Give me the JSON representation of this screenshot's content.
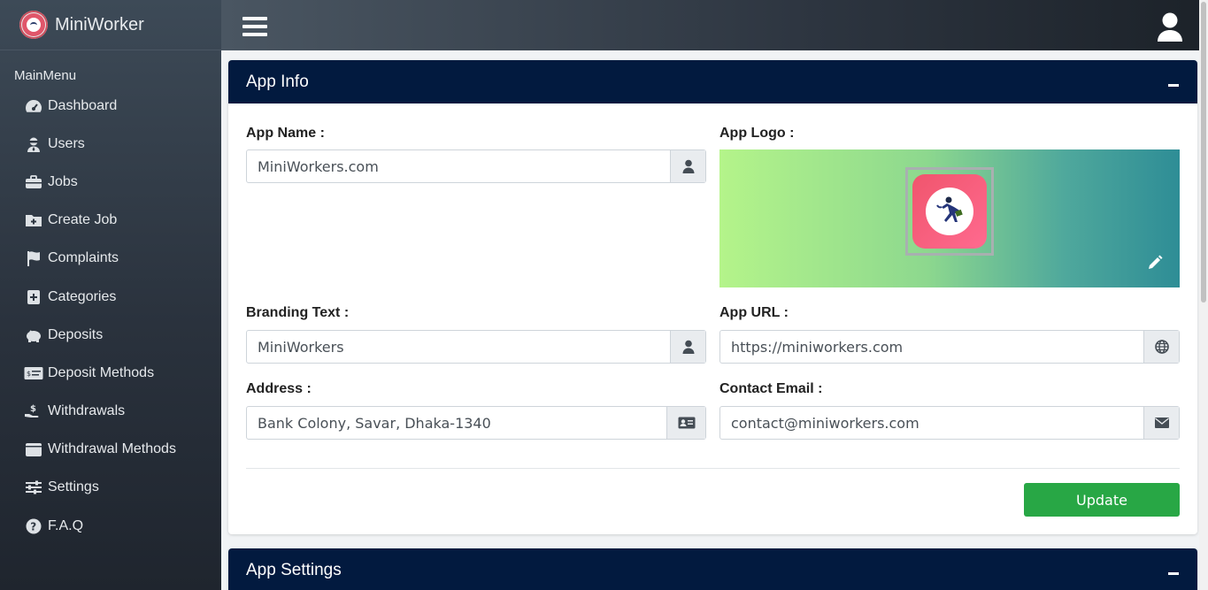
{
  "brand": {
    "name": "MiniWorker"
  },
  "sidebar": {
    "section_title": "MainMenu",
    "items": [
      {
        "label": "Dashboard",
        "icon": "tachometer-icon"
      },
      {
        "label": "Users",
        "icon": "user-secret-icon"
      },
      {
        "label": "Jobs",
        "icon": "briefcase-icon"
      },
      {
        "label": "Create Job",
        "icon": "folder-plus-icon"
      },
      {
        "label": "Complaints",
        "icon": "flag-icon"
      },
      {
        "label": "Categories",
        "icon": "plus-square-icon"
      },
      {
        "label": "Deposits",
        "icon": "piggy-bank-icon"
      },
      {
        "label": "Deposit Methods",
        "icon": "money-check-icon"
      },
      {
        "label": "Withdrawals",
        "icon": "hand-holding-usd-icon"
      },
      {
        "label": "Withdrawal Methods",
        "icon": "wallet-icon"
      },
      {
        "label": "Settings",
        "icon": "sliders-icon"
      },
      {
        "label": "F.A.Q",
        "icon": "question-circle-icon"
      }
    ]
  },
  "app_info": {
    "title": "App Info",
    "app_name_label": "App Name :",
    "app_name_value": "MiniWorkers.com",
    "app_logo_label": "App Logo :",
    "branding_label": "Branding Text :",
    "branding_value": "MiniWorkers",
    "app_url_label": "App URL :",
    "app_url_value": "https://miniworkers.com",
    "address_label": "Address :",
    "address_value": "Bank Colony, Savar, Dhaka-1340",
    "contact_label": "Contact Email :",
    "contact_value": "contact@miniworkers.com",
    "update_label": "Update"
  },
  "app_settings": {
    "title": "App Settings"
  },
  "colors": {
    "header": "#021a3f",
    "update": "#28a745"
  }
}
